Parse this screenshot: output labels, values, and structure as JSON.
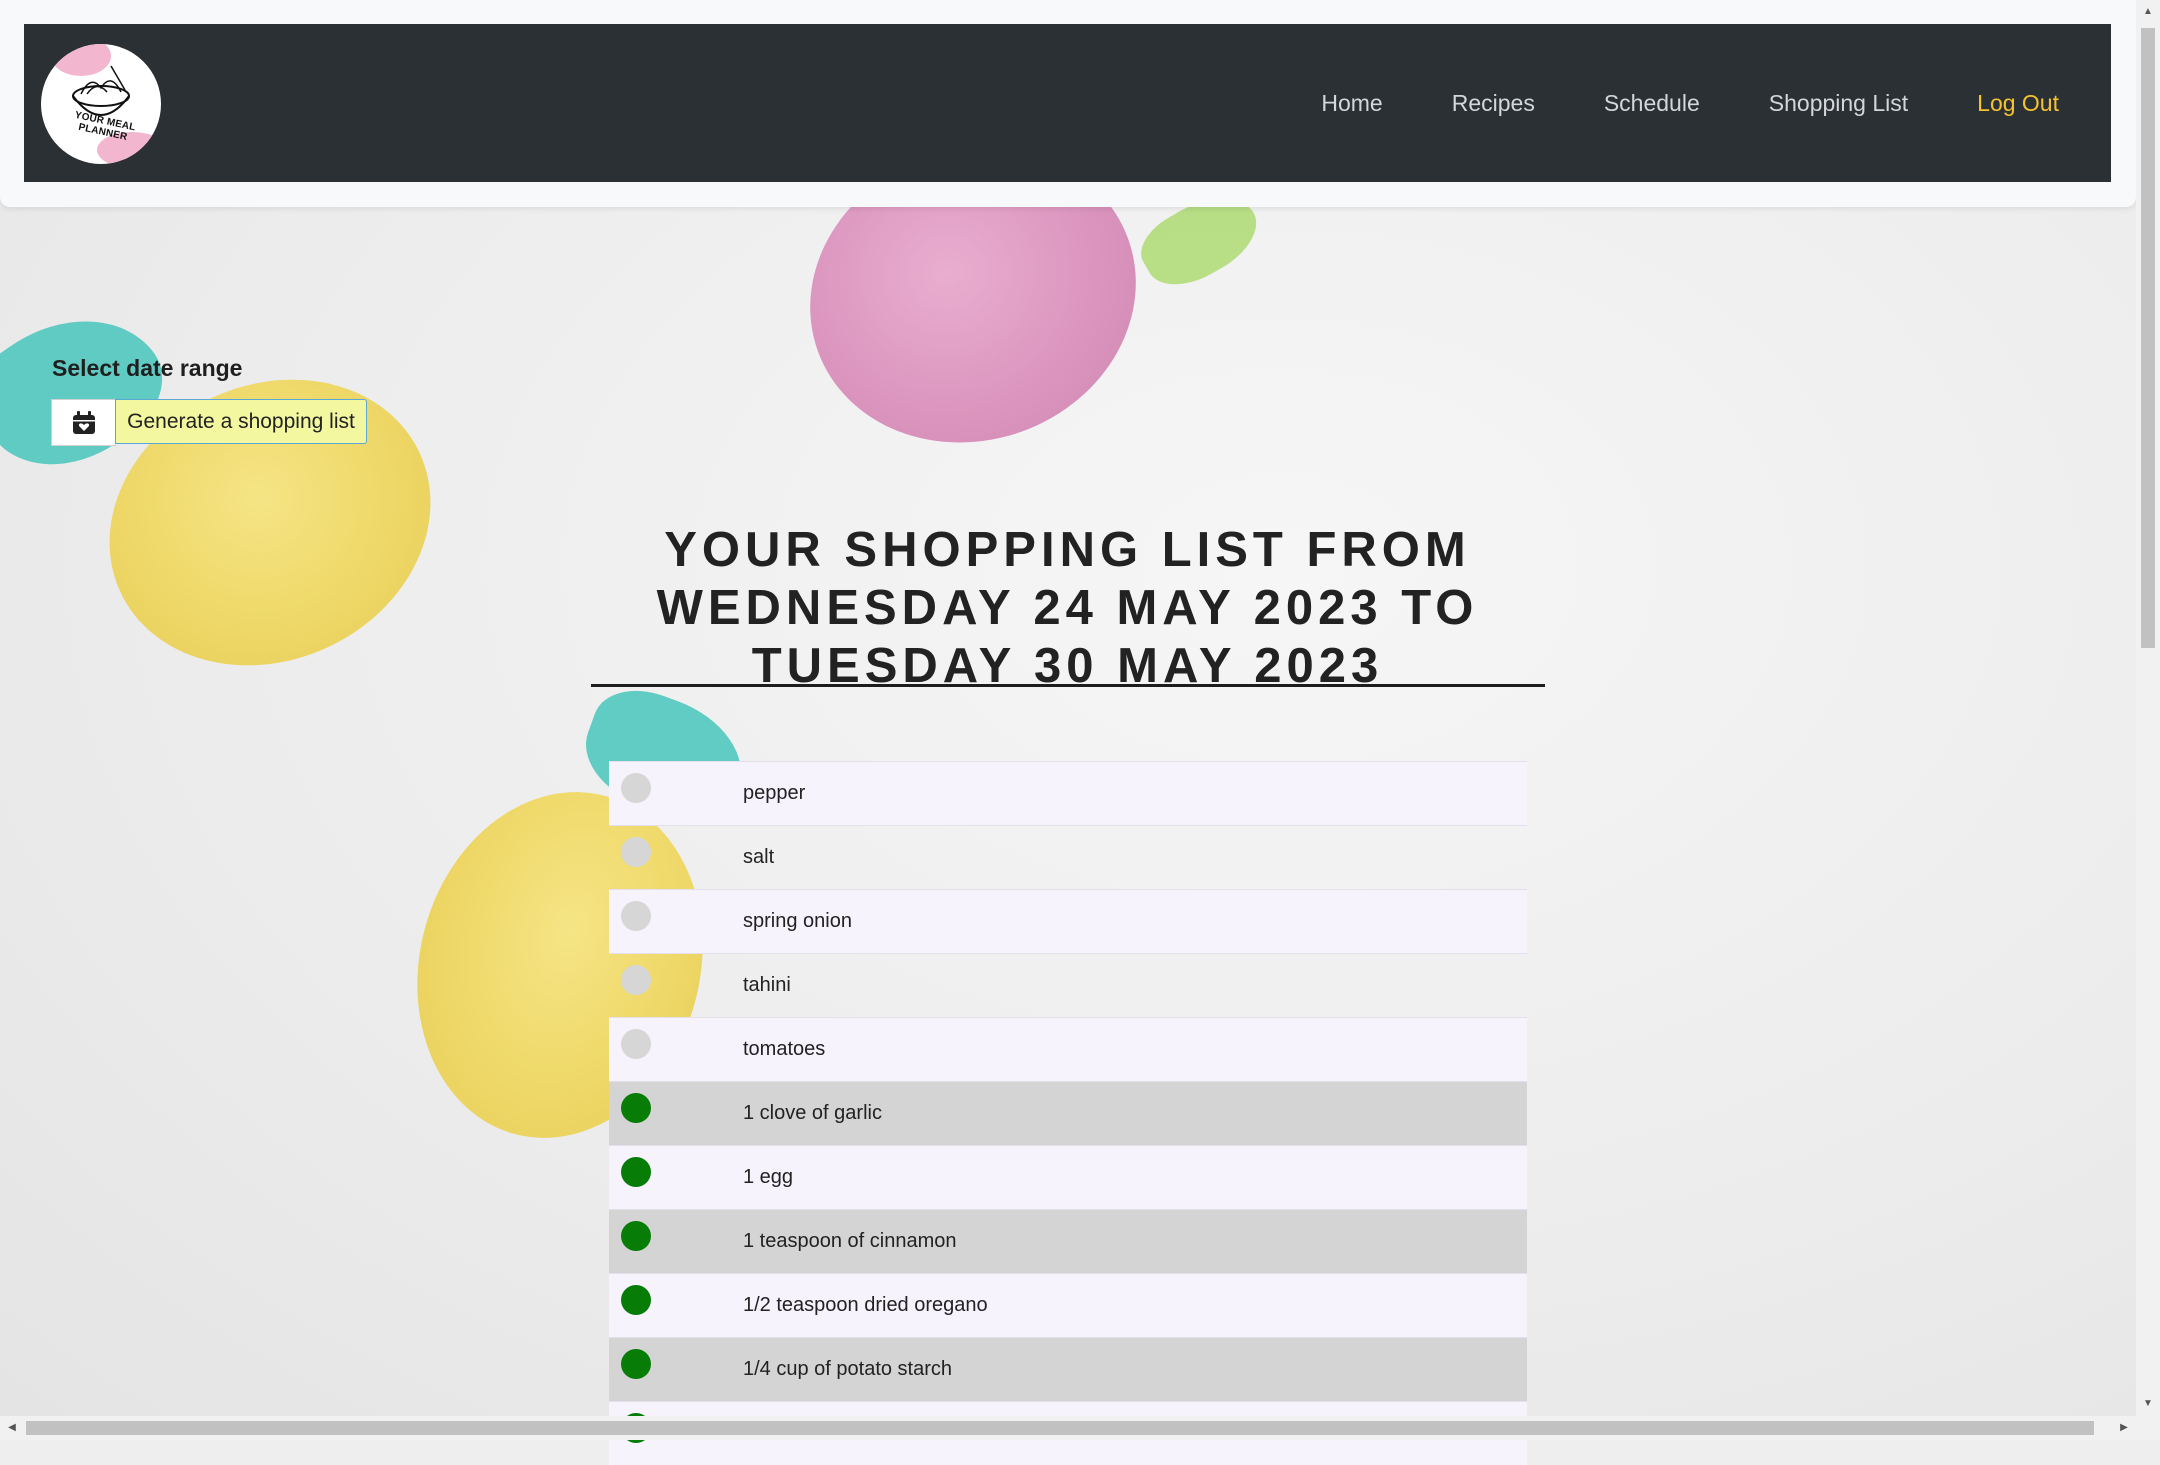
{
  "header": {
    "logo_text": "YOUR MEAL PLANNER",
    "nav": [
      {
        "label": "Home"
      },
      {
        "label": "Recipes"
      },
      {
        "label": "Schedule"
      },
      {
        "label": "Shopping List"
      },
      {
        "label": "Log Out"
      }
    ]
  },
  "controls": {
    "range_label": "Select date range",
    "calendar_icon": "calendar-icon",
    "generate_label": "Generate a shopping list"
  },
  "main": {
    "title": "Your shopping list from Wednesday 24 May 2023 to Tuesday 30 May 2023"
  },
  "items": [
    {
      "text": "pepper",
      "checked": false
    },
    {
      "text": "salt",
      "checked": false
    },
    {
      "text": "spring onion",
      "checked": false
    },
    {
      "text": "tahini",
      "checked": false
    },
    {
      "text": "tomatoes",
      "checked": false
    },
    {
      "text": "1 clove of garlic",
      "checked": true
    },
    {
      "text": "1 egg",
      "checked": true
    },
    {
      "text": "1 teaspoon of cinnamon",
      "checked": true
    },
    {
      "text": "1/2 teaspoon dried oregano",
      "checked": true
    },
    {
      "text": "1/4 cup of potato starch",
      "checked": true
    },
    {
      "text": "",
      "checked": true
    }
  ],
  "colors": {
    "navbar_bg": "#2b3035",
    "logout": "#f5c230",
    "generate_button_bg": "#f3f8a0",
    "checked_dot": "#077c07",
    "unchecked_dot": "#d6d6d6"
  }
}
